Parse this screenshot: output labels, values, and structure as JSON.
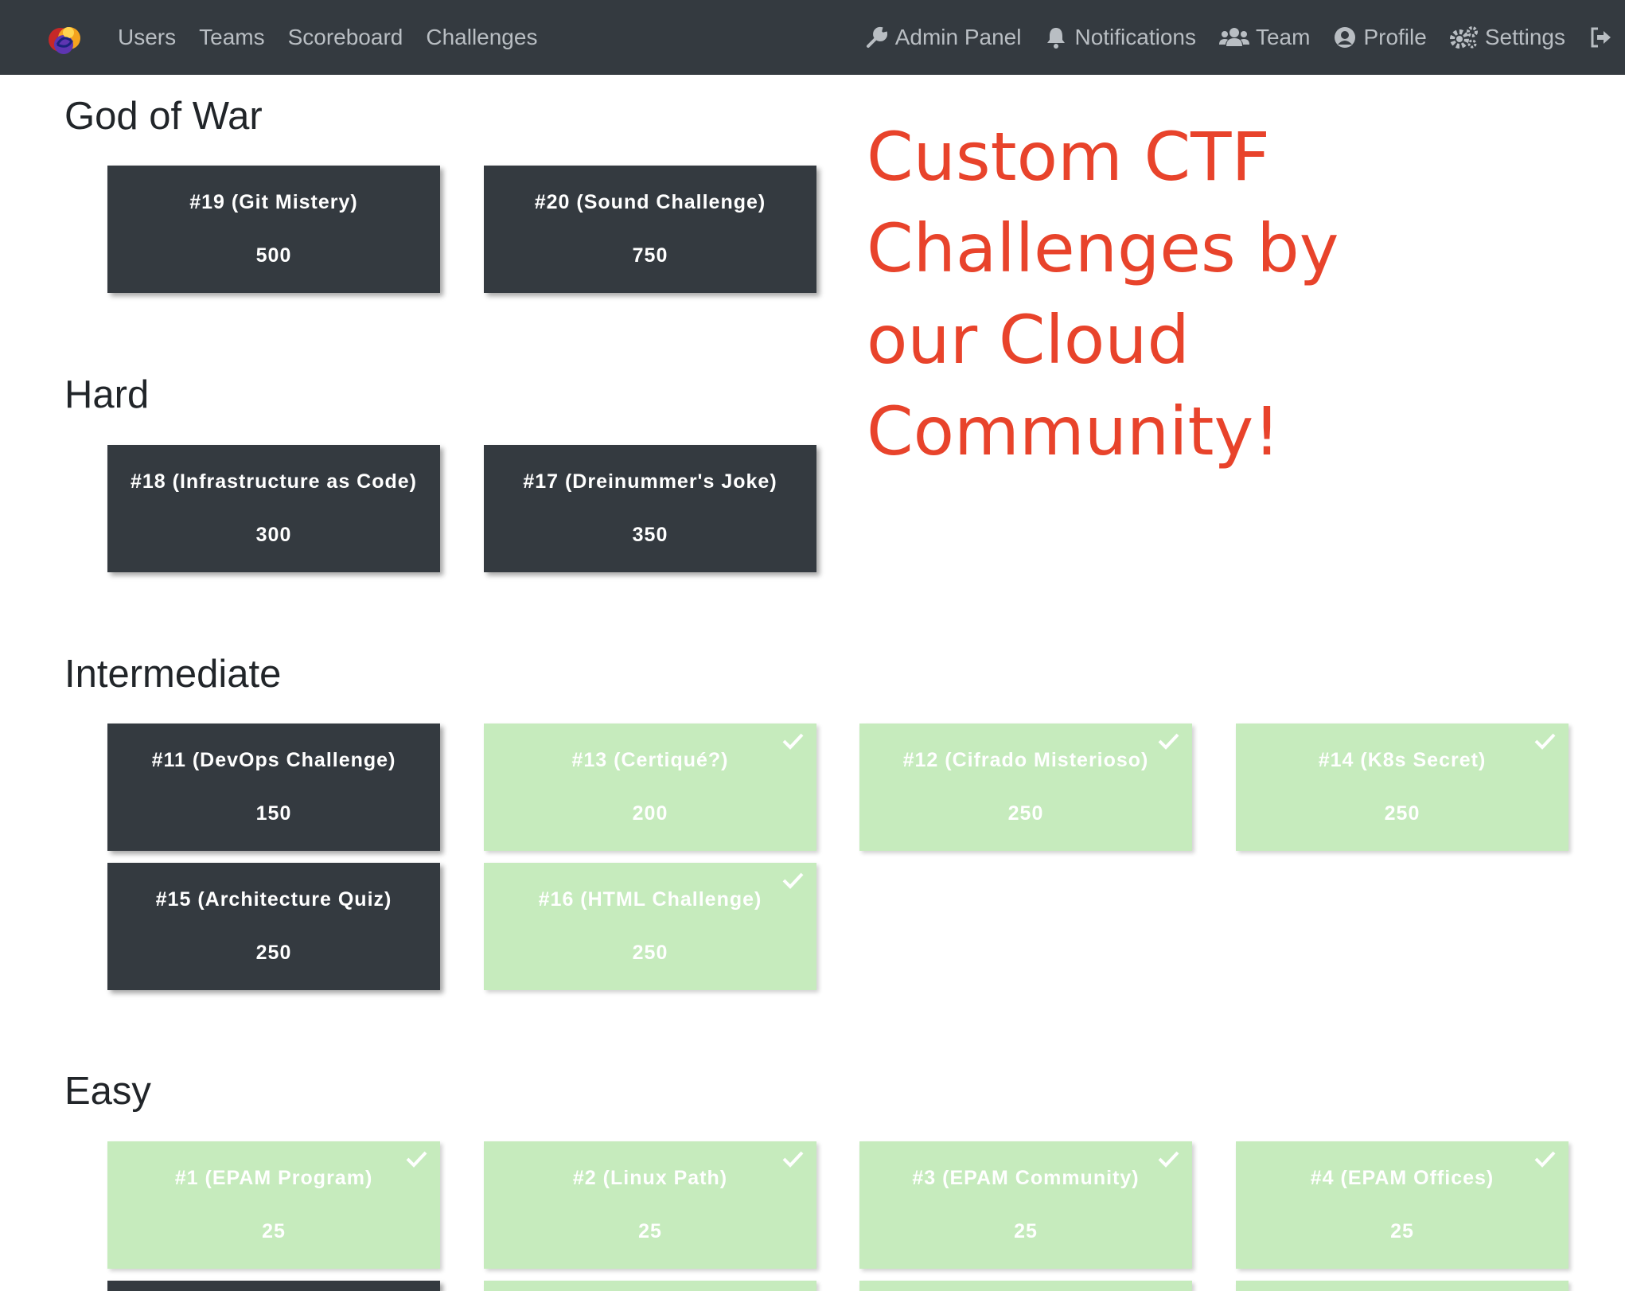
{
  "nav": {
    "left": [
      "Users",
      "Teams",
      "Scoreboard",
      "Challenges"
    ],
    "right": [
      {
        "label": "Admin Panel",
        "icon": "wrench-icon"
      },
      {
        "label": "Notifications",
        "icon": "bell-icon"
      },
      {
        "label": "Team",
        "icon": "users-icon"
      },
      {
        "label": "Profile",
        "icon": "user-circle-icon"
      },
      {
        "label": "Settings",
        "icon": "cogs-icon"
      }
    ],
    "logout_icon": "sign-out-icon"
  },
  "promo_text": "Custom CTF Challenges by our Cloud Community!",
  "categories": [
    {
      "name": "God of War",
      "challenges": [
        {
          "name": "#19 (Git Mistery)",
          "value": "500",
          "solved": false
        },
        {
          "name": "#20 (Sound Challenge)",
          "value": "750",
          "solved": false
        }
      ]
    },
    {
      "name": "Hard",
      "challenges": [
        {
          "name": "#18 (Infrastructure as Code)",
          "value": "300",
          "solved": false
        },
        {
          "name": "#17 (Dreinummer's Joke)",
          "value": "350",
          "solved": false
        }
      ]
    },
    {
      "name": "Intermediate",
      "challenges": [
        {
          "name": "#11 (DevOps Challenge)",
          "value": "150",
          "solved": false
        },
        {
          "name": "#13 (Certiqué?)",
          "value": "200",
          "solved": true
        },
        {
          "name": "#12 (Cifrado Misterioso)",
          "value": "250",
          "solved": true
        },
        {
          "name": "#14 (K8s Secret)",
          "value": "250",
          "solved": true
        },
        {
          "name": "#15 (Architecture Quiz)",
          "value": "250",
          "solved": false
        },
        {
          "name": "#16 (HTML Challenge)",
          "value": "250",
          "solved": true
        }
      ]
    },
    {
      "name": "Easy",
      "challenges": [
        {
          "name": "#1 (EPAM Program)",
          "value": "25",
          "solved": true
        },
        {
          "name": "#2 (Linux Path)",
          "value": "25",
          "solved": true
        },
        {
          "name": "#3 (EPAM Community)",
          "value": "25",
          "solved": true
        },
        {
          "name": "#4 (EPAM Offices)",
          "value": "25",
          "solved": true
        }
      ]
    }
  ],
  "colors": {
    "navbar": "#343a40",
    "unsolved": "#343a40",
    "solved": "#c6ebbd",
    "promo": "#e8432b"
  }
}
